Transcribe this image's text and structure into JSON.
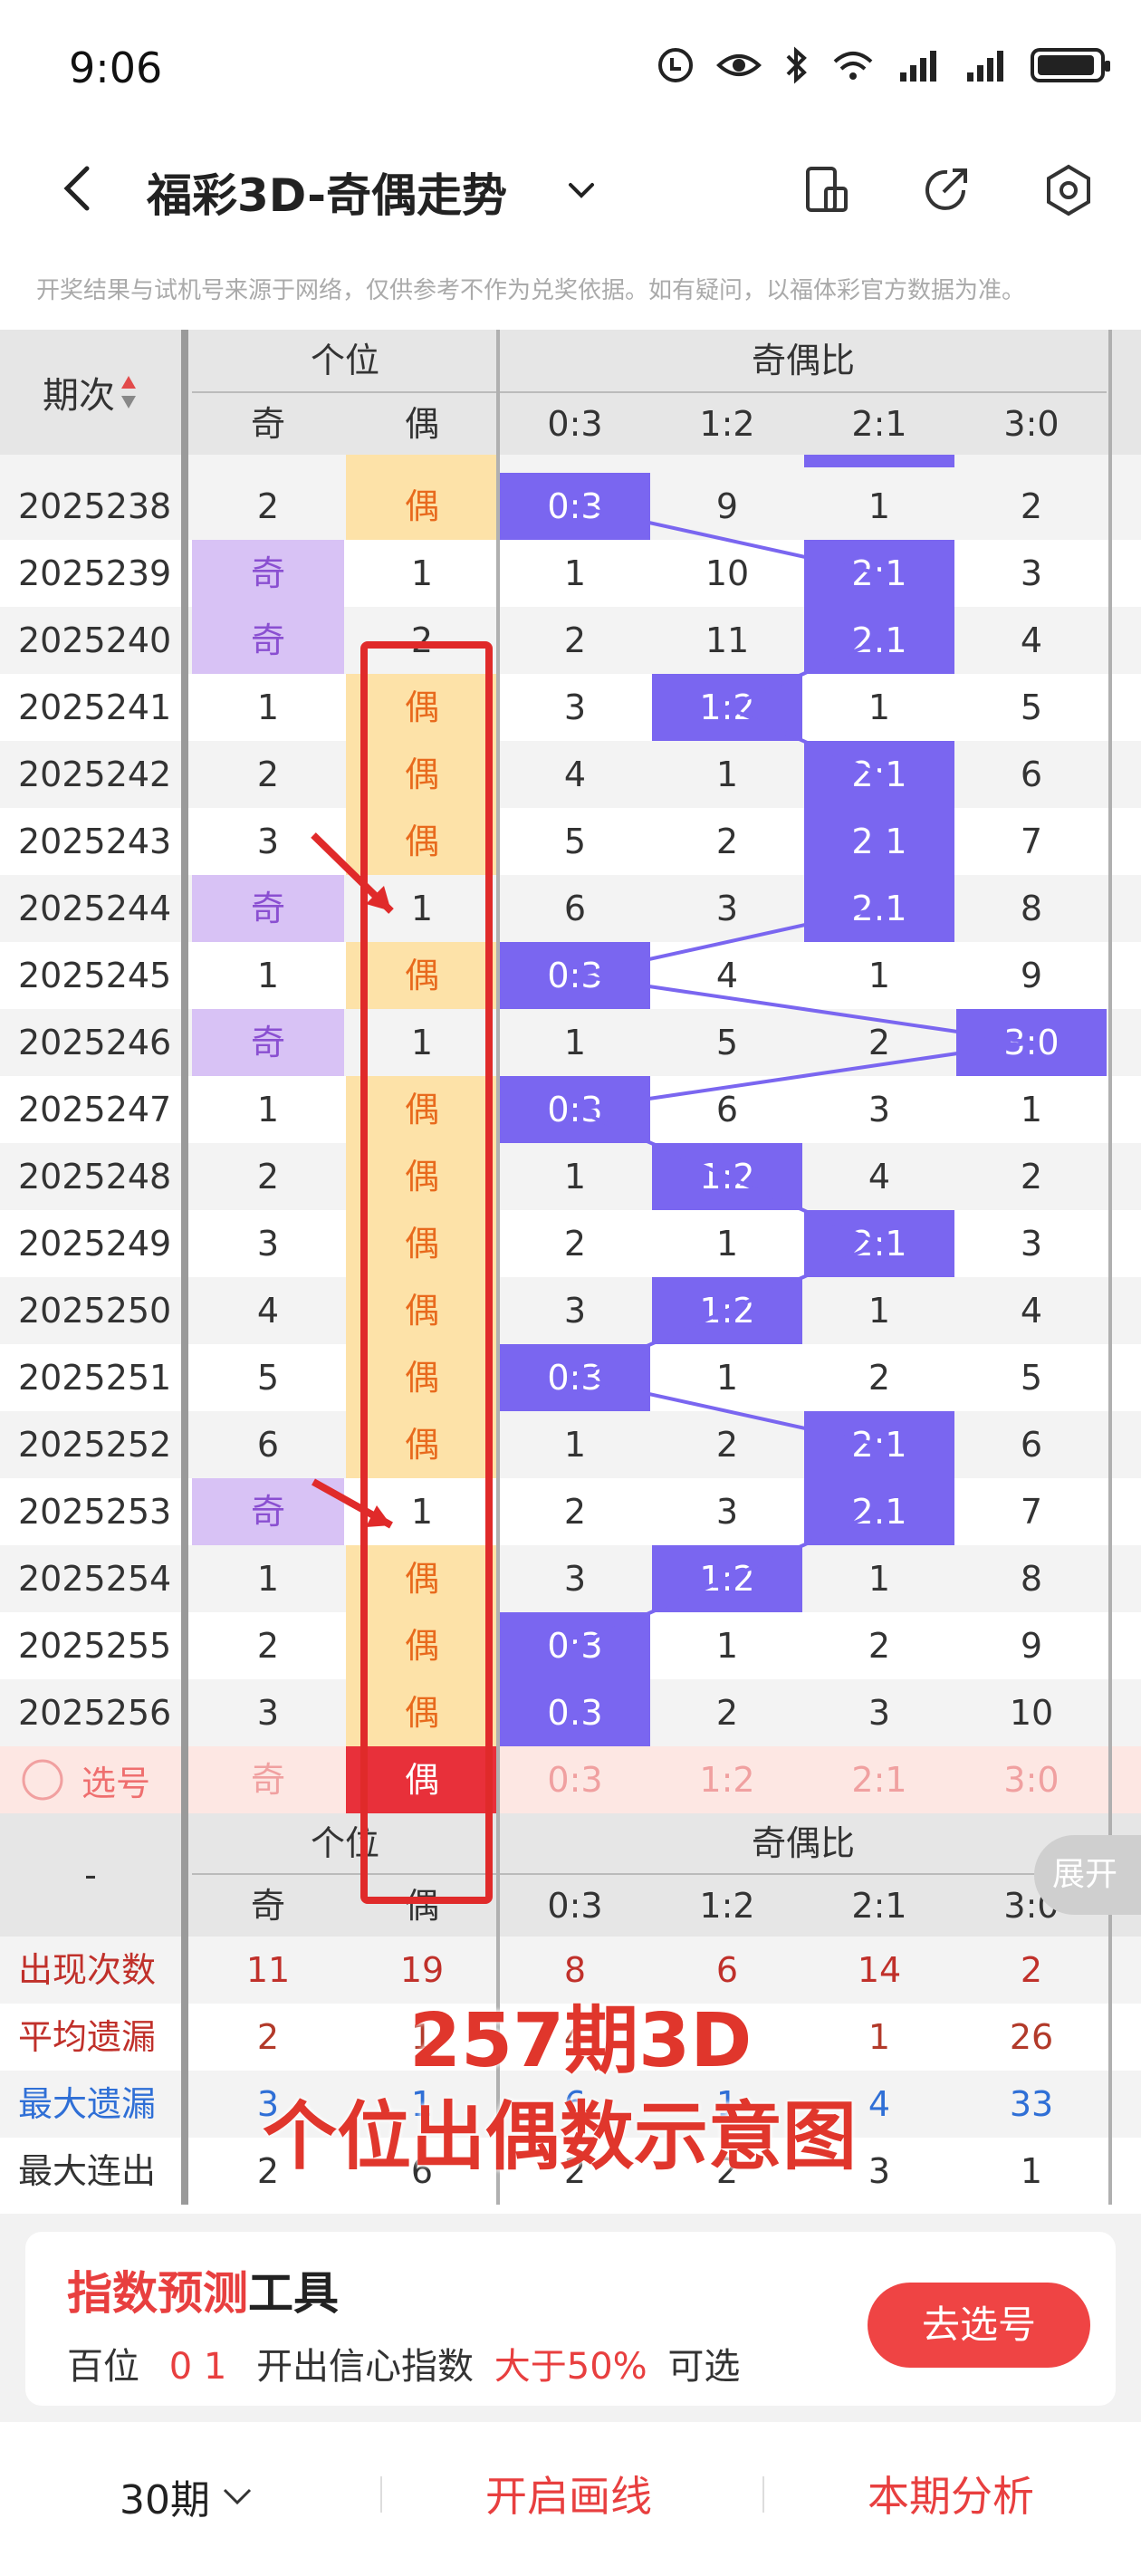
{
  "status": {
    "time": "9:06"
  },
  "header": {
    "title": "福彩3D-奇偶走势"
  },
  "notice": "开奖结果与试机号来源于网络，仅供参考不作为兑奖依据。如有疑问，以福体彩官方数据为准。",
  "table": {
    "col_period": "期次",
    "group1": "个位",
    "group2": "奇偶比",
    "sub": [
      "奇",
      "偶",
      "0:3",
      "1:2",
      "2:1",
      "3:0"
    ],
    "rows": [
      {
        "p": "2025238",
        "qi": "2",
        "ou": "偶",
        "hl": "ou",
        "r": [
          "0:3",
          "9",
          "1",
          "2"
        ],
        "ri": 0
      },
      {
        "p": "2025239",
        "qi": "奇",
        "ou": "1",
        "hl": "qi",
        "r": [
          "1",
          "10",
          "2:1",
          "3"
        ],
        "ri": 2
      },
      {
        "p": "2025240",
        "qi": "奇",
        "ou": "2",
        "hl": "qi",
        "r": [
          "2",
          "11",
          "2:1",
          "4"
        ],
        "ri": 2
      },
      {
        "p": "2025241",
        "qi": "1",
        "ou": "偶",
        "hl": "ou",
        "r": [
          "3",
          "1:2",
          "1",
          "5"
        ],
        "ri": 1
      },
      {
        "p": "2025242",
        "qi": "2",
        "ou": "偶",
        "hl": "ou",
        "r": [
          "4",
          "1",
          "2:1",
          "6"
        ],
        "ri": 2
      },
      {
        "p": "2025243",
        "qi": "3",
        "ou": "偶",
        "hl": "ou",
        "r": [
          "5",
          "2",
          "2:1",
          "7"
        ],
        "ri": 2
      },
      {
        "p": "2025244",
        "qi": "奇",
        "ou": "1",
        "hl": "qi",
        "r": [
          "6",
          "3",
          "2:1",
          "8"
        ],
        "ri": 2
      },
      {
        "p": "2025245",
        "qi": "1",
        "ou": "偶",
        "hl": "ou",
        "r": [
          "0:3",
          "4",
          "1",
          "9"
        ],
        "ri": 0
      },
      {
        "p": "2025246",
        "qi": "奇",
        "ou": "1",
        "hl": "qi",
        "r": [
          "1",
          "5",
          "2",
          "3:0"
        ],
        "ri": 3
      },
      {
        "p": "2025247",
        "qi": "1",
        "ou": "偶",
        "hl": "ou",
        "r": [
          "0:3",
          "6",
          "3",
          "1"
        ],
        "ri": 0
      },
      {
        "p": "2025248",
        "qi": "2",
        "ou": "偶",
        "hl": "ou",
        "r": [
          "1",
          "1:2",
          "4",
          "2"
        ],
        "ri": 1
      },
      {
        "p": "2025249",
        "qi": "3",
        "ou": "偶",
        "hl": "ou",
        "r": [
          "2",
          "1",
          "2:1",
          "3"
        ],
        "ri": 2
      },
      {
        "p": "2025250",
        "qi": "4",
        "ou": "偶",
        "hl": "ou",
        "r": [
          "3",
          "1:2",
          "1",
          "4"
        ],
        "ri": 1
      },
      {
        "p": "2025251",
        "qi": "5",
        "ou": "偶",
        "hl": "ou",
        "r": [
          "0:3",
          "1",
          "2",
          "5"
        ],
        "ri": 0
      },
      {
        "p": "2025252",
        "qi": "6",
        "ou": "偶",
        "hl": "ou",
        "r": [
          "1",
          "2",
          "2:1",
          "6"
        ],
        "ri": 2
      },
      {
        "p": "2025253",
        "qi": "奇",
        "ou": "1",
        "hl": "qi",
        "r": [
          "2",
          "3",
          "2:1",
          "7"
        ],
        "ri": 2
      },
      {
        "p": "2025254",
        "qi": "1",
        "ou": "偶",
        "hl": "ou",
        "r": [
          "3",
          "1:2",
          "1",
          "8"
        ],
        "ri": 1
      },
      {
        "p": "2025255",
        "qi": "2",
        "ou": "偶",
        "hl": "ou",
        "r": [
          "0:3",
          "1",
          "2",
          "9"
        ],
        "ri": 0
      },
      {
        "p": "2025256",
        "qi": "3",
        "ou": "偶",
        "hl": "ou",
        "r": [
          "0:3",
          "2",
          "3",
          "10"
        ],
        "ri": 0
      }
    ],
    "select_row": {
      "label": "选号",
      "cells": [
        "奇",
        "偶",
        "0:3",
        "1:2",
        "2:1",
        "3:0"
      ]
    },
    "footer_header": {
      "dash": "-",
      "group1": "个位",
      "group2": "奇偶比"
    },
    "stats": [
      {
        "label": "出现次数",
        "vals": [
          "11",
          "19",
          "8",
          "6",
          "14",
          "2"
        ]
      },
      {
        "label": "平均遗漏",
        "vals": [
          "2",
          "1",
          "4",
          "",
          "1",
          "26"
        ]
      },
      {
        "label": "最大遗漏",
        "vals": [
          "3",
          "1",
          "6",
          "1",
          "4",
          "33"
        ]
      },
      {
        "label": "最大连出",
        "vals": [
          "2",
          "6",
          "2",
          "2",
          "3",
          "1"
        ]
      }
    ]
  },
  "expand_label": "展开",
  "overlay_text": {
    "line1": "257期3D",
    "line2": "个位出偶数示意图"
  },
  "promo": {
    "title_red": "指数预测",
    "title_black": "工具",
    "desc_pos": "百位",
    "desc_nums": "0 1",
    "desc_mid": "开出信心指数",
    "desc_pct": "大于50%",
    "desc_end": "可选",
    "button": "去选号"
  },
  "bottom_bar": {
    "period": "30期",
    "draw": "开启画线",
    "analysis": "本期分析"
  }
}
